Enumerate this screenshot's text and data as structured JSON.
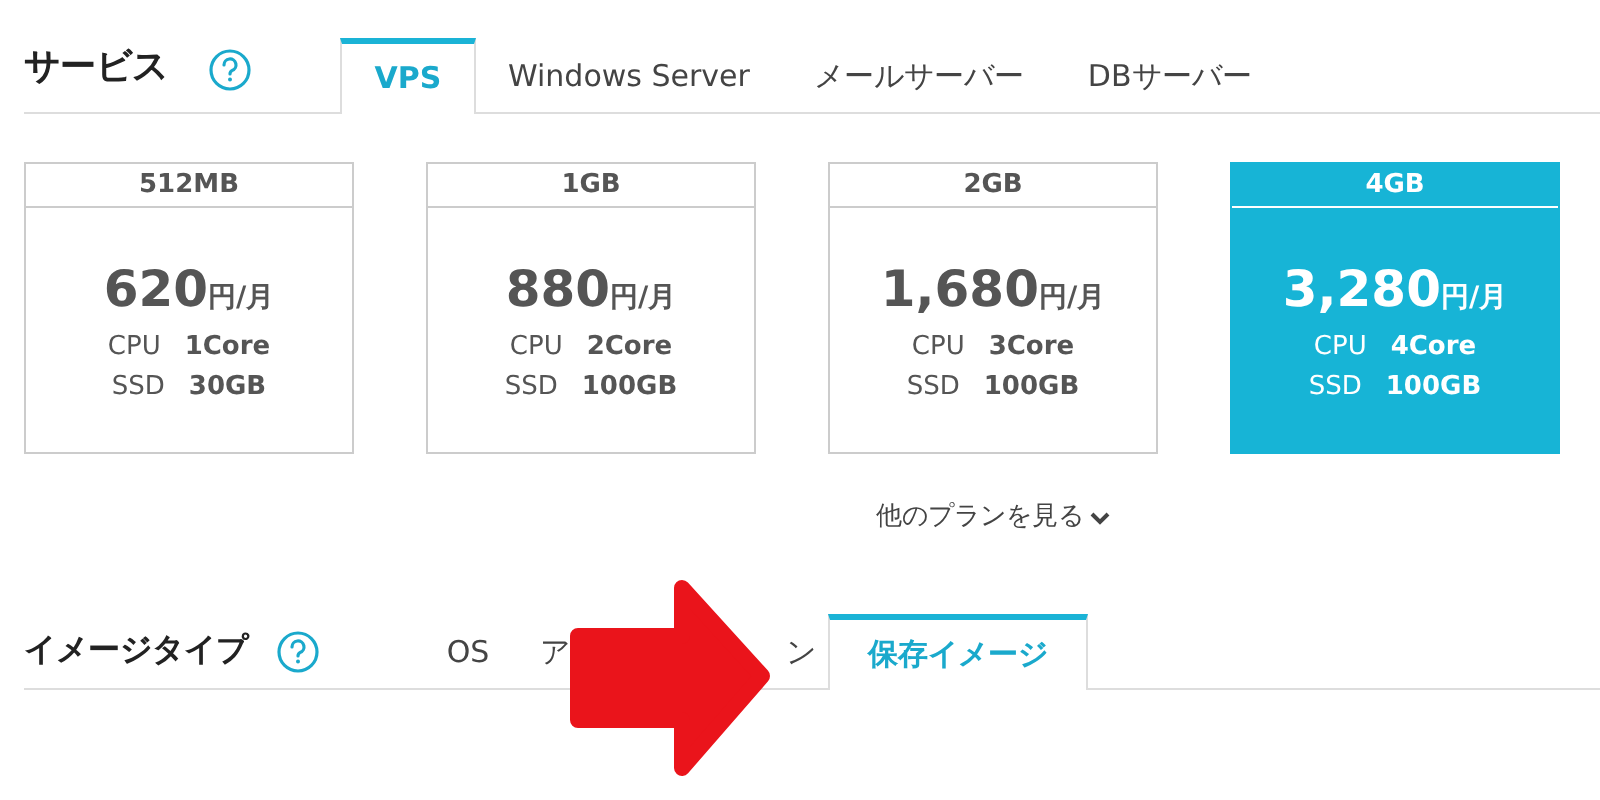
{
  "service": {
    "label": "サービス",
    "tabs": [
      {
        "label": "VPS",
        "selected": true
      },
      {
        "label": "Windows Server",
        "selected": false
      },
      {
        "label": "メールサーバー",
        "selected": false
      },
      {
        "label": "DBサーバー",
        "selected": false
      }
    ]
  },
  "plans": [
    {
      "memory": "512MB",
      "price": "620",
      "unit": "円/月",
      "cpu_label": "CPU",
      "cpu": "1Core",
      "ssd_label": "SSD",
      "ssd": "30GB",
      "selected": false
    },
    {
      "memory": "1GB",
      "price": "880",
      "unit": "円/月",
      "cpu_label": "CPU",
      "cpu": "2Core",
      "ssd_label": "SSD",
      "ssd": "100GB",
      "selected": false
    },
    {
      "memory": "2GB",
      "price": "1,680",
      "unit": "円/月",
      "cpu_label": "CPU",
      "cpu": "3Core",
      "ssd_label": "SSD",
      "ssd": "100GB",
      "selected": false
    },
    {
      "memory": "4GB",
      "price": "3,280",
      "unit": "円/月",
      "cpu_label": "CPU",
      "cpu": "4Core",
      "ssd_label": "SSD",
      "ssd": "100GB",
      "selected": true
    }
  ],
  "more_plans": "他のプランを見る",
  "image_type": {
    "label": "イメージタイプ",
    "tabs": [
      {
        "label": "OS",
        "selected": false
      },
      {
        "label_start": "ア",
        "label_end": "ン",
        "selected": false
      },
      {
        "label": "保存イメージ",
        "selected": true
      }
    ]
  }
}
